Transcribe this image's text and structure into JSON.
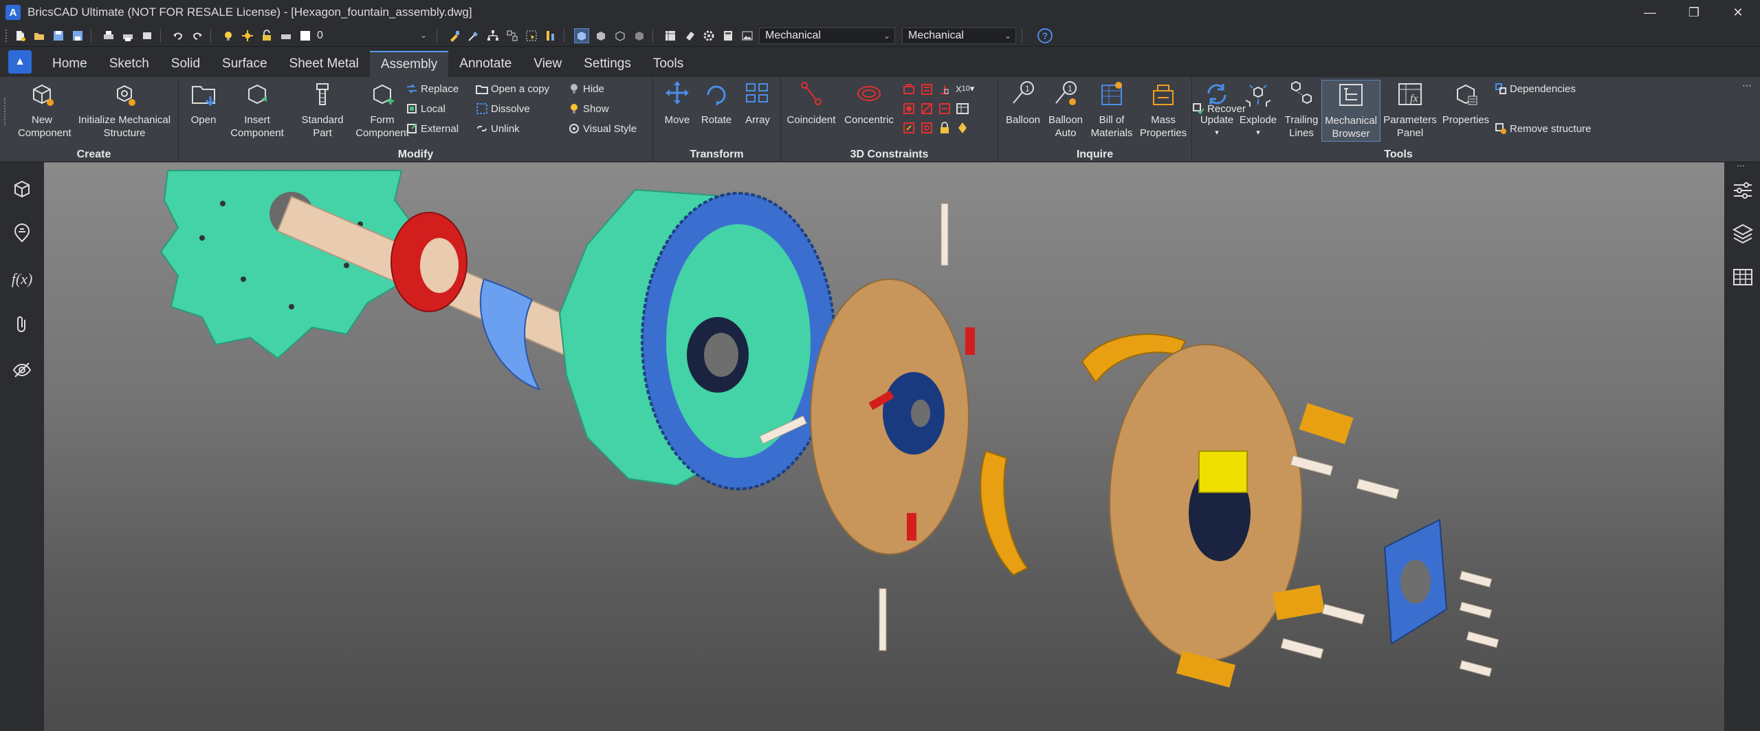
{
  "window": {
    "title": "BricsCAD Ultimate (NOT FOR RESALE License) - [Hexagon_fountain_assembly.dwg]",
    "controls": [
      "minimize",
      "restore",
      "close"
    ]
  },
  "quick_access": {
    "layer_value": "0",
    "workspace_1": "Mechanical",
    "workspace_2": "Mechanical"
  },
  "tabs": [
    {
      "label": "Home",
      "active": false
    },
    {
      "label": "Sketch",
      "active": false
    },
    {
      "label": "Solid",
      "active": false
    },
    {
      "label": "Surface",
      "active": false
    },
    {
      "label": "Sheet Metal",
      "active": false
    },
    {
      "label": "Assembly",
      "active": true
    },
    {
      "label": "Annotate",
      "active": false
    },
    {
      "label": "View",
      "active": false
    },
    {
      "label": "Settings",
      "active": false
    },
    {
      "label": "Tools",
      "active": false
    }
  ],
  "ribbon": {
    "create": {
      "title": "Create",
      "new_component": "New Component",
      "init_structure": "Initialize Mechanical Structure"
    },
    "modify": {
      "title": "Modify",
      "open": "Open",
      "insert_component": "Insert Component",
      "standard_part": "Standard Part",
      "form_component": "Form Component",
      "replace": "Replace",
      "local": "Local",
      "external": "External",
      "open_copy": "Open a copy",
      "dissolve": "Dissolve",
      "unlink": "Unlink",
      "hide": "Hide",
      "show": "Show",
      "visual_style": "Visual Style"
    },
    "transform": {
      "title": "Transform",
      "move": "Move",
      "rotate": "Rotate",
      "array": "Array"
    },
    "constraints": {
      "title": "3D Constraints",
      "coincident": "Coincident",
      "concentric": "Concentric"
    },
    "inquire": {
      "title": "Inquire",
      "balloon": "Balloon",
      "balloon_auto": "Balloon Auto",
      "bom": "Bill of Materials",
      "mass_properties": "Mass Properties"
    },
    "tools": {
      "title": "Tools",
      "update": "Update",
      "explode": "Explode",
      "trailing_lines": "Trailing Lines",
      "mech_browser": "Mechanical Browser",
      "params_panel": "Parameters Panel",
      "properties": "Properties",
      "dependencies": "Dependencies",
      "recover": "Recover",
      "remove_structure": "Remove structure"
    }
  },
  "colors": {
    "accent": "#2f6bd8",
    "teal_gear": "#43d3a6",
    "blue_ring": "#3a6fd0",
    "bronze_plate": "#c8955a",
    "red_part": "#d31e1e",
    "orange_part": "#e8a012",
    "yellow_block": "#f0e000"
  }
}
